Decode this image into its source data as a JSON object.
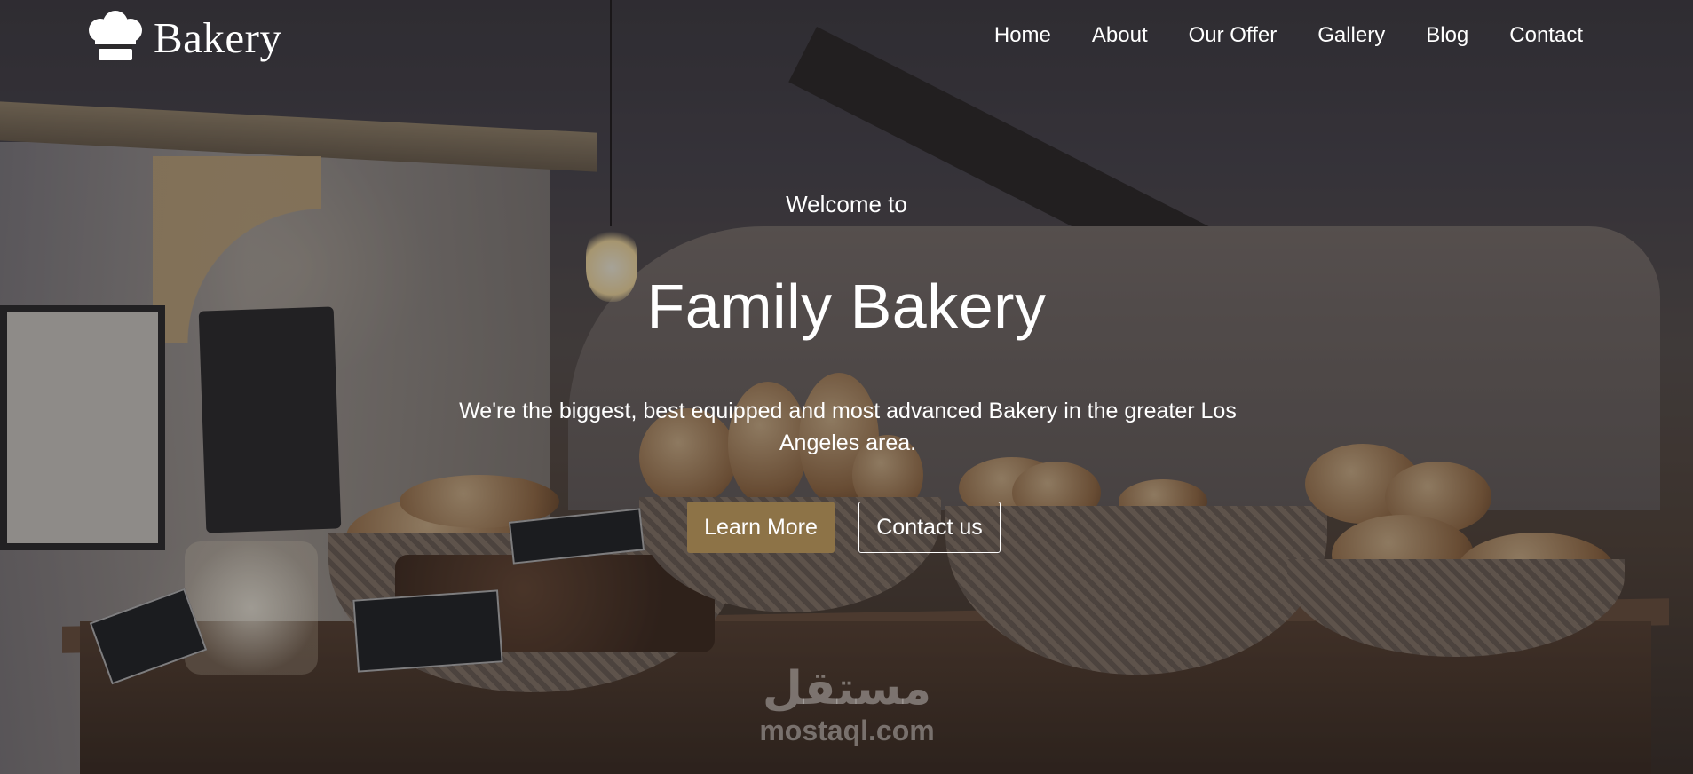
{
  "brand": {
    "name": "Bakery",
    "icon": "chef-hat-icon"
  },
  "nav": [
    {
      "label": "Home"
    },
    {
      "label": "About"
    },
    {
      "label": "Our Offer"
    },
    {
      "label": "Gallery"
    },
    {
      "label": "Blog"
    },
    {
      "label": "Contact"
    }
  ],
  "hero": {
    "welcome": "Welcome to",
    "title": "Family Bakery",
    "description": "We're the biggest, best equipped and most advanced Bakery in the greater Los Angeles area.",
    "primary_button": "Learn More",
    "secondary_button": "Contact us",
    "primary_color": "#8d7347"
  },
  "watermark": {
    "arabic": "مستقل",
    "latin": "mostaql.com"
  }
}
